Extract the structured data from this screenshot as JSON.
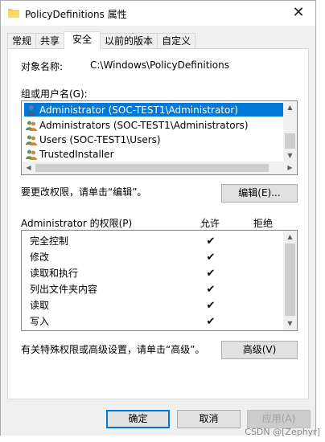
{
  "window": {
    "title": "PolicyDefinitions 属性",
    "close_glyph": "✕"
  },
  "tabs": [
    {
      "label": "常规",
      "active": false
    },
    {
      "label": "共享",
      "active": false
    },
    {
      "label": "安全",
      "active": true
    },
    {
      "label": "以前的版本",
      "active": false
    },
    {
      "label": "自定义",
      "active": false
    }
  ],
  "security": {
    "object_name_label": "对象名称:",
    "object_name_value": "C:\\Windows\\PolicyDefinitions",
    "groups_label": "组或用户名(G):",
    "groups": [
      {
        "name": "Administrator (SOC-TEST1\\Administrator)",
        "icon": "user-icon",
        "selected": true
      },
      {
        "name": "Administrators (SOC-TEST1\\Administrators)",
        "icon": "group-icon",
        "selected": false
      },
      {
        "name": "Users (SOC-TEST1\\Users)",
        "icon": "group-icon",
        "selected": false
      },
      {
        "name": "TrustedInstaller",
        "icon": "group-icon",
        "selected": false
      }
    ],
    "edit_hint": "要更改权限，请单击“编辑”。",
    "edit_button": "编辑(E)...",
    "perm_header": "Administrator 的权限(P)",
    "allow_header": "允许",
    "deny_header": "拒绝",
    "permissions": [
      {
        "name": "完全控制",
        "allow": true,
        "deny": false
      },
      {
        "name": "修改",
        "allow": true,
        "deny": false
      },
      {
        "name": "读取和执行",
        "allow": true,
        "deny": false
      },
      {
        "name": "列出文件夹内容",
        "allow": true,
        "deny": false
      },
      {
        "name": "读取",
        "allow": true,
        "deny": false
      },
      {
        "name": "写入",
        "allow": true,
        "deny": false
      }
    ],
    "check_glyph": "✔",
    "advanced_hint": "有关特殊权限或高级设置，请单击“高级”。",
    "advanced_button": "高级(V)"
  },
  "footer": {
    "ok": "确定",
    "cancel": "取消",
    "apply": "应用(A)"
  },
  "watermark": "CSDN @[Zephyr]",
  "colors": {
    "selection": "#0078d7",
    "dialog_bg": "#f0f0f0",
    "folder_yellow": "#f3c94d"
  }
}
